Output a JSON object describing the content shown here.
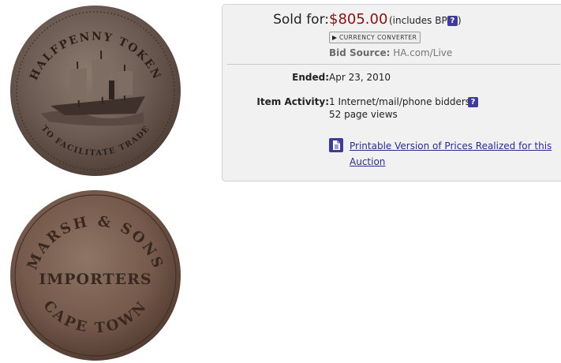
{
  "coins": {
    "obverse": {
      "alt": "Obverse of halfpenny token with sailing steamship",
      "legend_top": "HALFPENNY TOKEN",
      "legend_bottom": "TO FACILITATE TRADE"
    },
    "reverse": {
      "alt": "Reverse of Marsh & Sons token",
      "line_top": "MARSH & SONS",
      "line_middle": "IMPORTERS",
      "line_bottom": "CAPE TOWN"
    }
  },
  "sale": {
    "sold_label": "Sold for:",
    "price": "$805.00",
    "bp_note": "(includes BP",
    "bp_note_close": ")",
    "currency_converter": "CURRENCY CONVERTER",
    "bid_source_label": "Bid Source:",
    "bid_source_value": "HA.com/Live"
  },
  "details": {
    "ended_label": "Ended:",
    "ended_value": "Apr 23, 2010",
    "activity_label": "Item Activity:",
    "bidders": "1 Internet/mail/phone bidders",
    "page_views": "52 page views"
  },
  "printable": {
    "link_text": "Printable Version of Prices Realized for this Auction"
  },
  "icons": {
    "help": "?",
    "help_icon": "question-mark-icon",
    "document_icon": "document-icon"
  },
  "colors": {
    "price": "#8b1010",
    "help_badge": "#3f3b99",
    "link": "#2b2b8c",
    "panel_bg": "#f1f1f1"
  }
}
